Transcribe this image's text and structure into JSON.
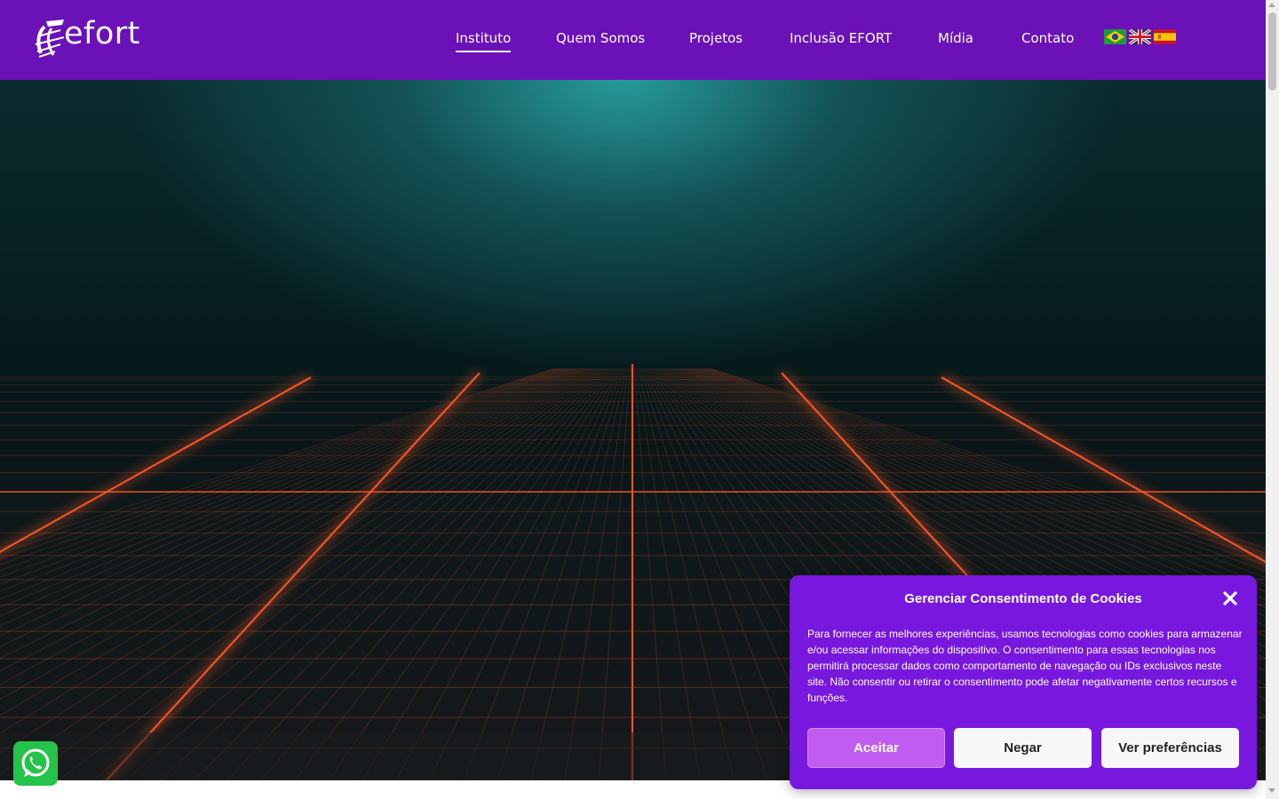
{
  "header": {
    "logo_text": "efort",
    "nav": [
      {
        "label": "Instituto",
        "active": true
      },
      {
        "label": "Quem Somos",
        "active": false
      },
      {
        "label": "Projetos",
        "active": false
      },
      {
        "label": "Inclusão EFORT",
        "active": false
      },
      {
        "label": "Mídia",
        "active": false
      },
      {
        "label": "Contato",
        "active": false
      }
    ],
    "languages": [
      "pt-BR",
      "en-GB",
      "es-ES"
    ]
  },
  "hero": {
    "image": "teal spotlight over orange perspective neon grid"
  },
  "cookie_banner": {
    "title": "Gerenciar Consentimento de Cookies",
    "body": "Para fornecer as melhores experiências, usamos tecnologias como cookies para armazenar e/ou acessar informações do dispositivo. O consentimento para essas tecnologias nos permitirá processar dados como comportamento de navegação ou IDs exclusivos neste site. Não consentir ou retirar o consentimento pode afetar negativamente certos recursos e funções.",
    "accept_label": "Aceitar",
    "deny_label": "Negar",
    "preferences_label": "Ver preferências",
    "close_icon": "close-icon"
  },
  "floating": {
    "whatsapp_icon": "whatsapp-icon"
  },
  "colors": {
    "header_bg": "#6a11b8",
    "cookie_bg": "#7818de",
    "accept_bg": "#c05cf0",
    "grid_line": "#ff5a2a",
    "hero_glow": "#28a0a0",
    "whatsapp": "#26c34a"
  }
}
